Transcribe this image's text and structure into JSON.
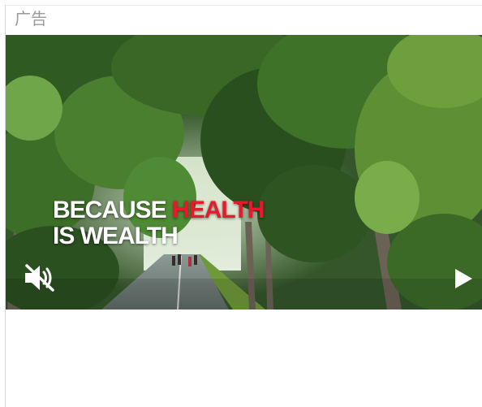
{
  "ad": {
    "label": "广告",
    "headline": {
      "line1_prefix": "BECAUSE ",
      "line1_accent": "HEALTH",
      "line2": "IS WEALTH"
    },
    "accent_color": "#e8192c",
    "controls": {
      "mute_icon": "speaker-muted-icon",
      "play_icon": "play-icon"
    }
  }
}
